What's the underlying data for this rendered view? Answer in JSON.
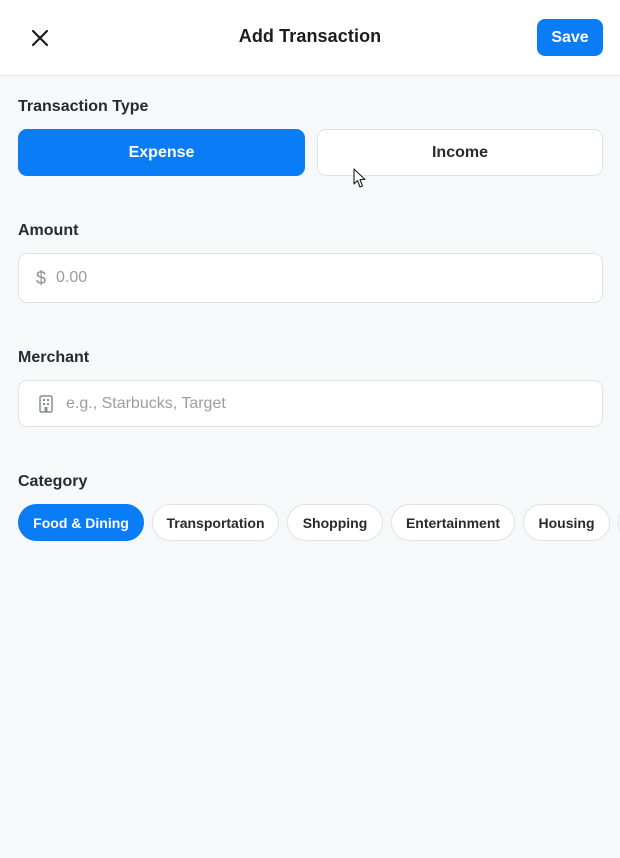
{
  "header": {
    "title": "Add Transaction",
    "close_icon": "close-icon",
    "save_label": "Save"
  },
  "transaction_type": {
    "label": "Transaction Type",
    "options": [
      "Expense",
      "Income"
    ],
    "selected": "Expense"
  },
  "amount": {
    "label": "Amount",
    "currency_symbol": "$",
    "value": "",
    "placeholder": "0.00"
  },
  "merchant": {
    "label": "Merchant",
    "icon": "building-icon",
    "value": "",
    "placeholder": "e.g., Starbucks, Target"
  },
  "category": {
    "label": "Category",
    "chips": [
      "Food & Dining",
      "Transportation",
      "Shopping",
      "Entertainment",
      "Housing"
    ],
    "selected": "Food & Dining"
  },
  "colors": {
    "accent": "#0a7cf5",
    "background": "#f7f8fa",
    "surface": "#ffffff",
    "border": "#dfe2e6"
  }
}
